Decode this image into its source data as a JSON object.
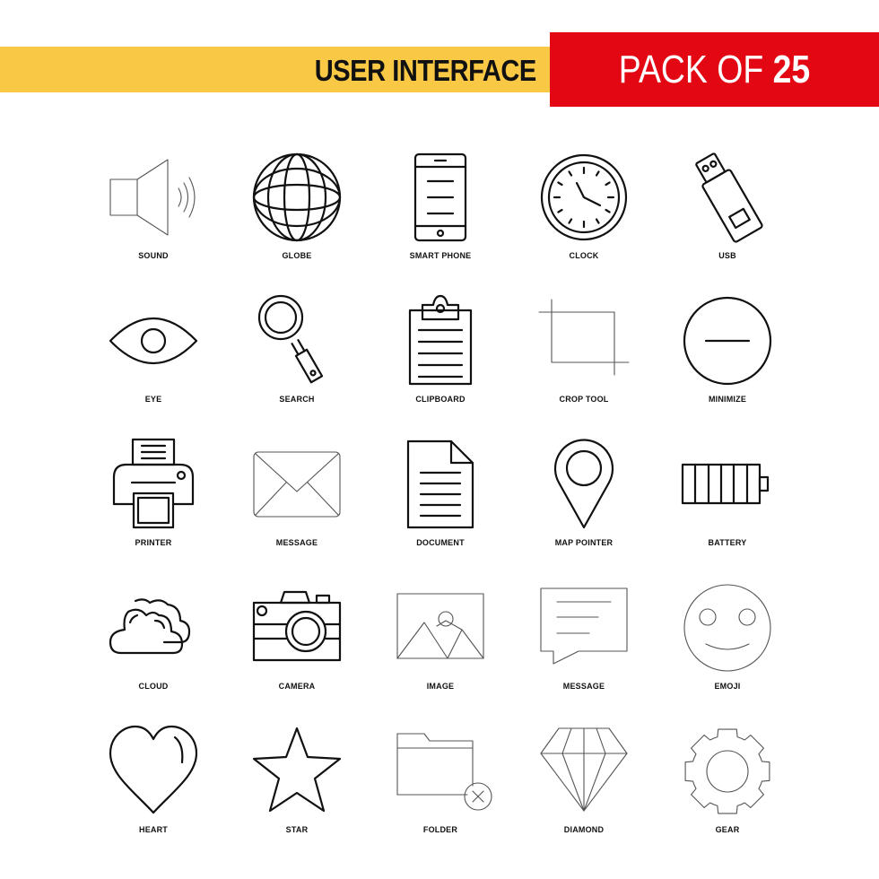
{
  "banner": {
    "title": "USER INTERFACE",
    "pack_prefix": "PACK OF ",
    "pack_count": "25",
    "colors": {
      "yellow": "#F9C844",
      "red": "#E30613"
    }
  },
  "icons": [
    {
      "label": "SOUND",
      "icon": "sound-icon"
    },
    {
      "label": "GLOBE",
      "icon": "globe-icon"
    },
    {
      "label": "SMART PHONE",
      "icon": "smart-phone-icon"
    },
    {
      "label": "CLOCK",
      "icon": "clock-icon"
    },
    {
      "label": "USB",
      "icon": "usb-icon"
    },
    {
      "label": "EYE",
      "icon": "eye-icon"
    },
    {
      "label": "SEARCH",
      "icon": "search-icon"
    },
    {
      "label": "CLIPBOARD",
      "icon": "clipboard-icon"
    },
    {
      "label": "CROP TOOL",
      "icon": "crop-tool-icon"
    },
    {
      "label": "MINIMIZE",
      "icon": "minimize-icon"
    },
    {
      "label": "PRINTER",
      "icon": "printer-icon"
    },
    {
      "label": "MESSAGE",
      "icon": "envelope-icon"
    },
    {
      "label": "DOCUMENT",
      "icon": "document-icon"
    },
    {
      "label": "MAP POINTER",
      "icon": "map-pointer-icon"
    },
    {
      "label": "BATTERY",
      "icon": "battery-icon"
    },
    {
      "label": "CLOUD",
      "icon": "cloud-icon"
    },
    {
      "label": "CAMERA",
      "icon": "camera-icon"
    },
    {
      "label": "IMAGE",
      "icon": "image-icon"
    },
    {
      "label": "MESSAGE",
      "icon": "chat-bubble-icon"
    },
    {
      "label": "EMOJI",
      "icon": "emoji-icon"
    },
    {
      "label": "HEART",
      "icon": "heart-icon"
    },
    {
      "label": "STAR",
      "icon": "star-icon"
    },
    {
      "label": "FOLDER",
      "icon": "folder-icon"
    },
    {
      "label": "DIAMOND",
      "icon": "diamond-icon"
    },
    {
      "label": "GEAR",
      "icon": "gear-icon"
    }
  ]
}
